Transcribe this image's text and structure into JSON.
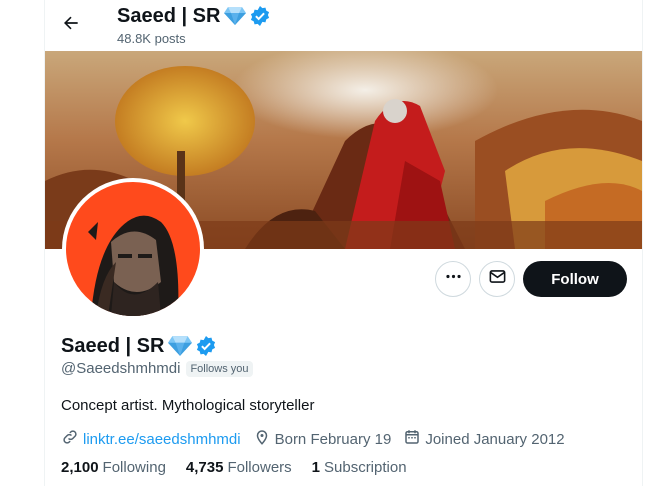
{
  "header": {
    "display_name": "Saeed | SR",
    "posts_count": "48.8K posts"
  },
  "profile": {
    "display_name": "Saeed | SR",
    "handle": "@Saeedshmhmdi",
    "follows_you": "Follows you",
    "bio": "Concept artist. Mythological storyteller",
    "link": "linktr.ee/saeedshmhmdi",
    "born": "Born February 19",
    "joined": "Joined January 2012"
  },
  "actions": {
    "follow_label": "Follow"
  },
  "stats": {
    "following_count": "2,100",
    "following_label": "Following",
    "followers_count": "4,735",
    "followers_label": "Followers",
    "subscription_count": "1",
    "subscription_label": "Subscription"
  },
  "icons": {
    "back": "arrow-left-icon",
    "diamond": "diamond-emoji-icon",
    "verified": "verified-badge-icon",
    "more": "more-dots-icon",
    "message": "envelope-icon",
    "link": "link-icon",
    "location": "location-pin-icon",
    "calendar": "calendar-icon"
  },
  "colors": {
    "accent": "#1d9bf0",
    "text_primary": "#0f1419",
    "text_secondary": "#536471",
    "follow_button_bg": "#0f1419",
    "avatar_bg": "#ff4a1c"
  }
}
